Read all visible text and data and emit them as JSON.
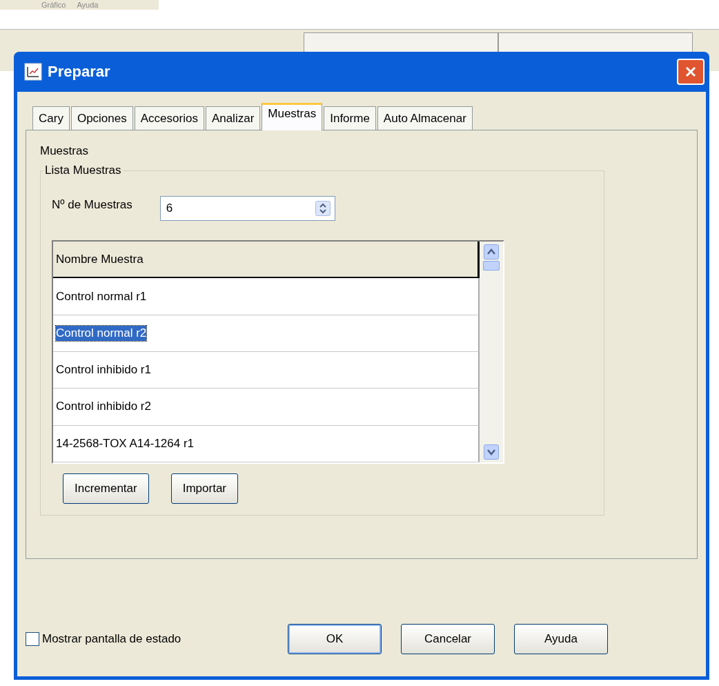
{
  "app_menu": [
    "Gráfico",
    "Ayuda"
  ],
  "dialog": {
    "title": "Preparar",
    "tabs": [
      {
        "label": "Cary",
        "selected": false
      },
      {
        "label": "Opciones",
        "selected": false
      },
      {
        "label": "Accesorios",
        "selected": false
      },
      {
        "label": "Analizar",
        "selected": false
      },
      {
        "label": "Muestras",
        "selected": true
      },
      {
        "label": "Informe",
        "selected": false
      },
      {
        "label": "Auto Almacenar",
        "selected": false
      }
    ],
    "section_label": "Muestras",
    "group": {
      "title": "Lista Muestras",
      "count_label": "Nº de Muestras",
      "count_value": "6",
      "table": {
        "column": "Nombre Muestra",
        "rows": [
          {
            "name": "Control normal r1",
            "selected": false
          },
          {
            "name": "Control normal r2",
            "selected": true
          },
          {
            "name": "Control inhibido r1",
            "selected": false
          },
          {
            "name": "Control inhibido r2",
            "selected": false
          },
          {
            "name": "14-2568-TOX A14-1264 r1",
            "selected": false
          }
        ]
      },
      "buttons": [
        "Incrementar",
        "Importar"
      ]
    },
    "status_checkbox": {
      "label": "Mostrar pantalla de estado",
      "checked": false
    },
    "buttons": [
      {
        "label": "OK",
        "default": true
      },
      {
        "label": "Cancelar",
        "default": false
      },
      {
        "label": "Ayuda",
        "default": false
      }
    ]
  }
}
